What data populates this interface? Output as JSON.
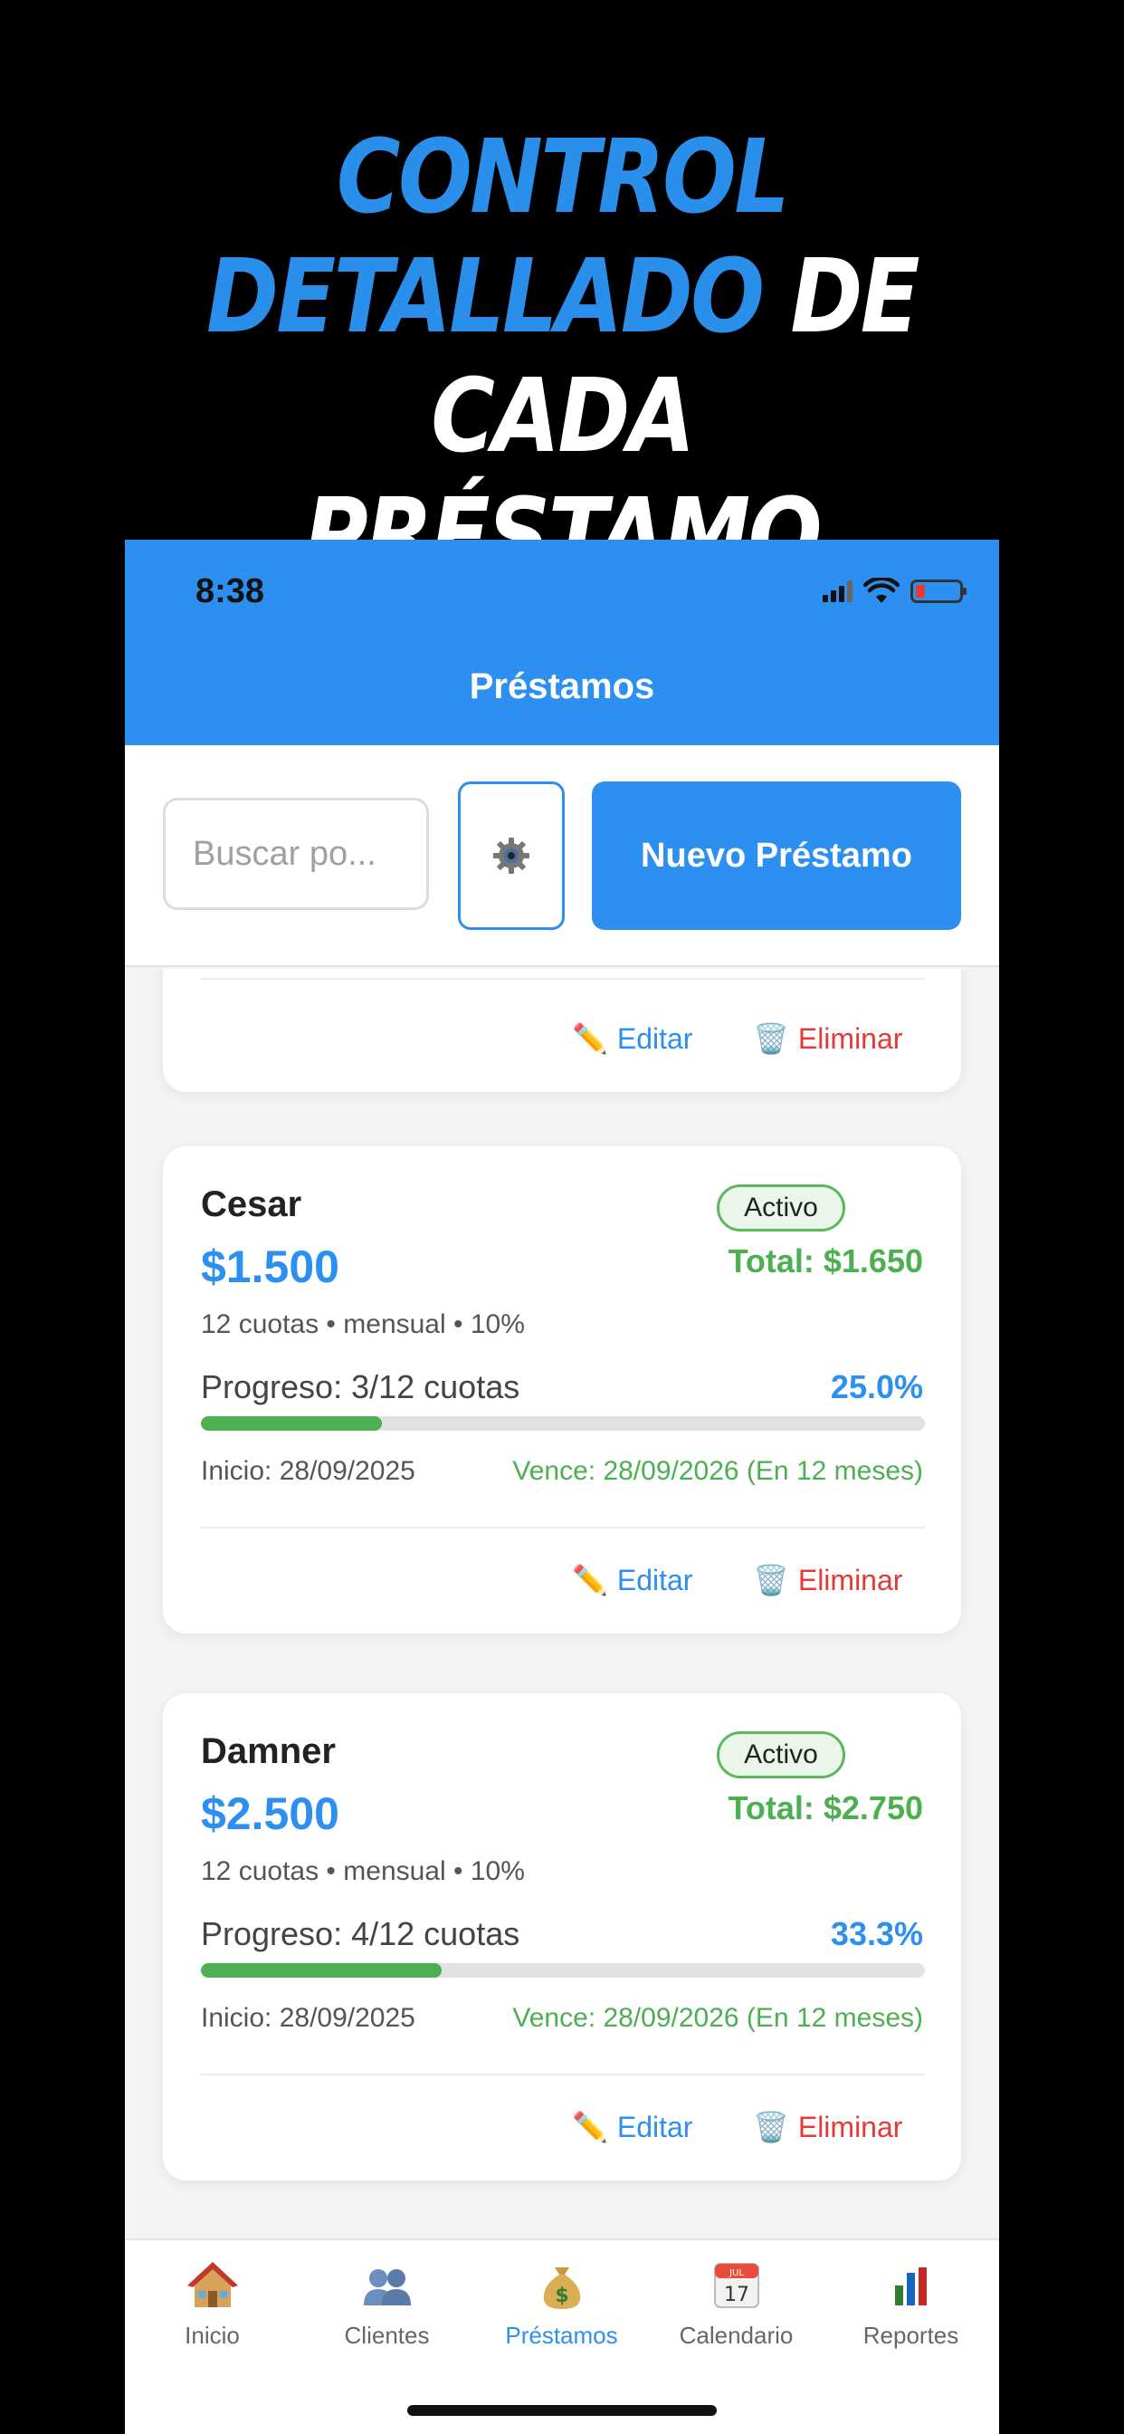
{
  "hero": {
    "line1": "CONTROL",
    "line2_blue": "DETALLADO",
    "line2_white": "DE CADA",
    "line3": "PRÉSTAMO"
  },
  "status_bar": {
    "time": "8:38"
  },
  "header": {
    "title": "Préstamos"
  },
  "toolbar": {
    "search_placeholder": "Buscar po...",
    "new_button": "Nuevo Préstamo"
  },
  "loans": [
    {
      "actions": {
        "edit": "Editar",
        "delete": "Eliminar"
      }
    },
    {
      "name": "Cesar",
      "badge": "Activo",
      "amount": "$1.500",
      "total": "Total: $1.650",
      "meta": "12 cuotas • mensual • 10%",
      "progress_label": "Progreso: 3/12 cuotas",
      "progress_pct": "25.0%",
      "progress_fraction": 0.25,
      "start": "Inicio: 28/09/2025",
      "due": "Vence: 28/09/2026 (En 12 meses)",
      "actions": {
        "edit": "Editar",
        "delete": "Eliminar"
      }
    },
    {
      "name": "Damner",
      "badge": "Activo",
      "amount": "$2.500",
      "total": "Total: $2.750",
      "meta": "12 cuotas • mensual • 10%",
      "progress_label": "Progreso: 4/12 cuotas",
      "progress_pct": "33.3%",
      "progress_fraction": 0.333,
      "start": "Inicio: 28/09/2025",
      "due": "Vence: 28/09/2026 (En 12 meses)",
      "actions": {
        "edit": "Editar",
        "delete": "Eliminar"
      }
    }
  ],
  "tabs": [
    {
      "label": "Inicio",
      "icon": "house-icon"
    },
    {
      "label": "Clientes",
      "icon": "users-icon"
    },
    {
      "label": "Préstamos",
      "icon": "money-bag-icon",
      "active": true
    },
    {
      "label": "Calendario",
      "icon": "calendar-icon",
      "calendar_month": "JUL",
      "calendar_day": "17"
    },
    {
      "label": "Reportes",
      "icon": "bar-chart-icon"
    }
  ],
  "colors": {
    "primary": "#2d8ff0",
    "success": "#4caf50",
    "danger": "#e53935"
  }
}
